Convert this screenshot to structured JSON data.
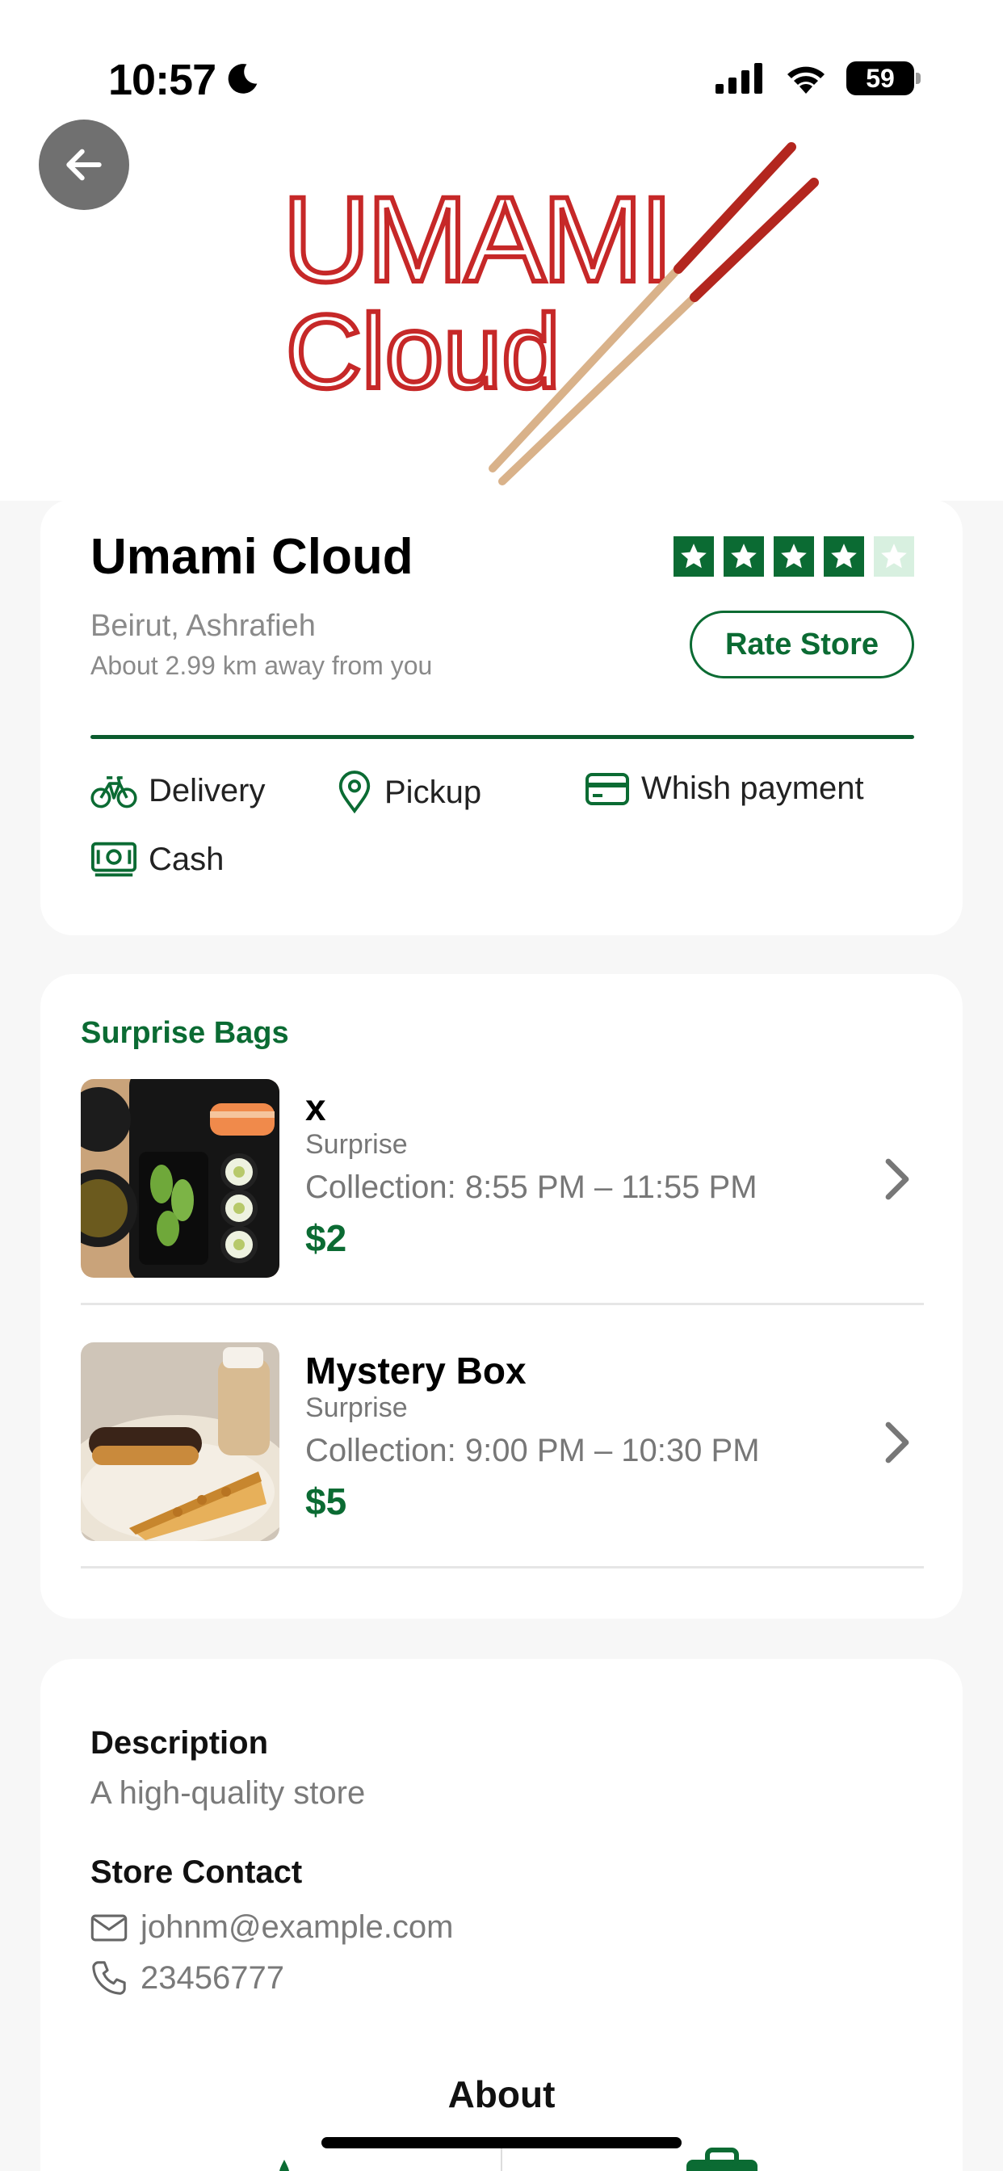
{
  "status_bar": {
    "time": "10:57",
    "battery": "59"
  },
  "header": {
    "logo_line1": "UMAMI",
    "logo_line2": "Cloud"
  },
  "store": {
    "name": "Umami Cloud",
    "rating": 4,
    "rating_max": 5,
    "location": "Beirut, Ashrafieh",
    "distance": "About 2.99 km away from you",
    "rate_button": "Rate Store",
    "features": [
      {
        "label": "Delivery",
        "icon": "bicycle-icon"
      },
      {
        "label": "Pickup",
        "icon": "map-pin-icon"
      },
      {
        "label": "Whish payment",
        "icon": "credit-card-icon"
      },
      {
        "label": "Cash",
        "icon": "cash-icon"
      }
    ]
  },
  "bags": {
    "section_title": "Surprise Bags",
    "items": [
      {
        "name": "x",
        "type": "Surprise",
        "collection": "Collection: 8:55 PM – 11:55 PM",
        "price": "$2"
      },
      {
        "name": "Mystery Box",
        "type": "Surprise",
        "collection": "Collection: 9:00 PM – 10:30 PM",
        "price": "$5"
      }
    ]
  },
  "details": {
    "description_label": "Description",
    "description": "A high-quality store",
    "contact_label": "Store Contact",
    "email": "johnm@example.com",
    "phone": "23456777",
    "about_label": "About"
  },
  "colors": {
    "accent": "#0b6b33",
    "logo_red": "#c62828"
  }
}
